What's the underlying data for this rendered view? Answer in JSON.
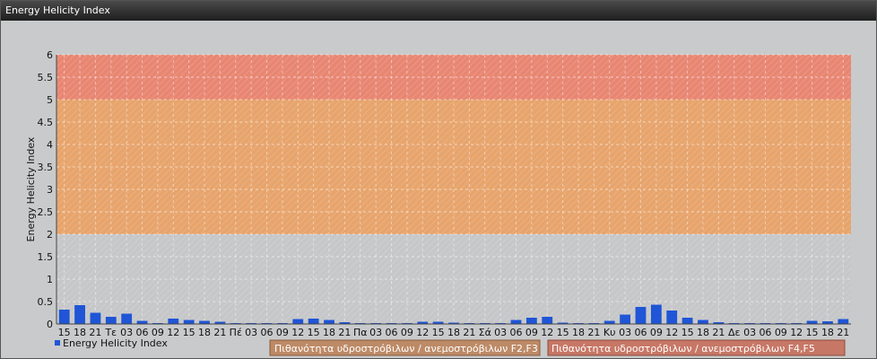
{
  "window": {
    "title": "Energy Helicity Index"
  },
  "chart_data": {
    "type": "bar",
    "ylabel": "Energy Helicity Index",
    "ylim": [
      0,
      6
    ],
    "yticks": [
      "0",
      "0.5",
      "1",
      "1.5",
      "2",
      "2.5",
      "3",
      "3.5",
      "4",
      "4.5",
      "5",
      "5.5",
      "6"
    ],
    "grid": true,
    "legend": "bottom-left",
    "categories": [
      "15",
      "18",
      "21",
      "Τε",
      "03",
      "06",
      "09",
      "12",
      "15",
      "18",
      "21",
      "Πέ",
      "03",
      "06",
      "09",
      "12",
      "15",
      "18",
      "21",
      "Πα",
      "03",
      "06",
      "09",
      "12",
      "15",
      "18",
      "21",
      "Σά",
      "03",
      "06",
      "09",
      "12",
      "15",
      "18",
      "21",
      "Κυ",
      "03",
      "06",
      "09",
      "12",
      "15",
      "18",
      "21",
      "Δε",
      "03",
      "06",
      "09",
      "12",
      "15",
      "18",
      "21"
    ],
    "series": [
      {
        "name": "Energy Helicity Index",
        "color": "#1f55d6",
        "values": [
          0.32,
          0.42,
          0.25,
          0.16,
          0.23,
          0.07,
          0.02,
          0.12,
          0.09,
          0.07,
          0.05,
          0.02,
          0.02,
          0.02,
          0.02,
          0.11,
          0.12,
          0.09,
          0.04,
          0.02,
          0.02,
          0.02,
          0.02,
          0.05,
          0.05,
          0.03,
          0.02,
          0.02,
          0.02,
          0.09,
          0.14,
          0.16,
          0.03,
          0.02,
          0.02,
          0.07,
          0.21,
          0.38,
          0.43,
          0.3,
          0.14,
          0.09,
          0.04,
          0.02,
          0.02,
          0.02,
          0.02,
          0.02,
          0.07,
          0.06,
          0.11
        ]
      }
    ],
    "bands": [
      {
        "from": 2,
        "to": 5,
        "color": "#e7a46c",
        "label": "Πιθανότητα υδροστρόβιλων / ανεμοστρόβιλων F2,F3"
      },
      {
        "from": 5,
        "to": 6,
        "color": "#e88672",
        "label": "Πιθανότητα υδροστρόβιλων / ανεμοστρόβιλων F4,F5"
      }
    ],
    "colors": {
      "band_label_border": "#a05a40",
      "plot_base": "#c6c7c9"
    }
  }
}
